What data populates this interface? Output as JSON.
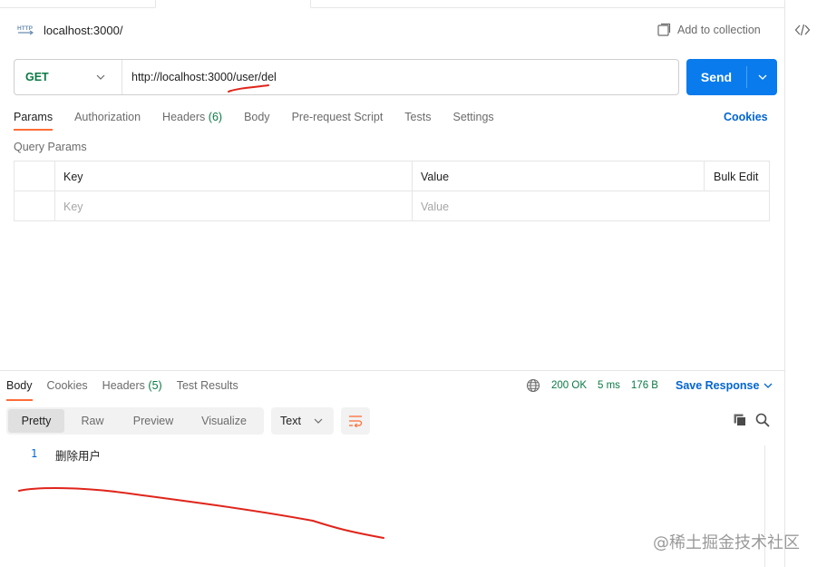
{
  "request": {
    "title": "localhost:3000/",
    "add_to_collection": "Add to collection",
    "method": "GET",
    "url": "http://localhost:3000/user/del",
    "send_label": "Send"
  },
  "request_tabs": {
    "params": "Params",
    "authorization": "Authorization",
    "headers": "Headers",
    "headers_count": "(6)",
    "body": "Body",
    "prerequest": "Pre-request Script",
    "tests": "Tests",
    "settings": "Settings",
    "cookies": "Cookies"
  },
  "query_params": {
    "title": "Query Params",
    "col_key": "Key",
    "col_value": "Value",
    "bulk_edit": "Bulk Edit",
    "key_placeholder": "Key",
    "value_placeholder": "Value"
  },
  "response_tabs": {
    "body": "Body",
    "cookies": "Cookies",
    "headers": "Headers",
    "headers_count": "(5)",
    "test_results": "Test Results"
  },
  "response_meta": {
    "status": "200 OK",
    "time": "5 ms",
    "size": "176 B",
    "save_response": "Save Response"
  },
  "view_modes": {
    "pretty": "Pretty",
    "raw": "Raw",
    "preview": "Preview",
    "visualize": "Visualize",
    "format": "Text"
  },
  "response_body": {
    "line_number": "1",
    "line_text": "删除用户"
  },
  "watermark": "@稀土掘金技术社区",
  "colors": {
    "send_blue": "#097bed",
    "accent_orange": "#ff6c37",
    "status_green": "#0b7a45",
    "link_blue": "#0265d2",
    "annotation_red": "#e0251b"
  }
}
